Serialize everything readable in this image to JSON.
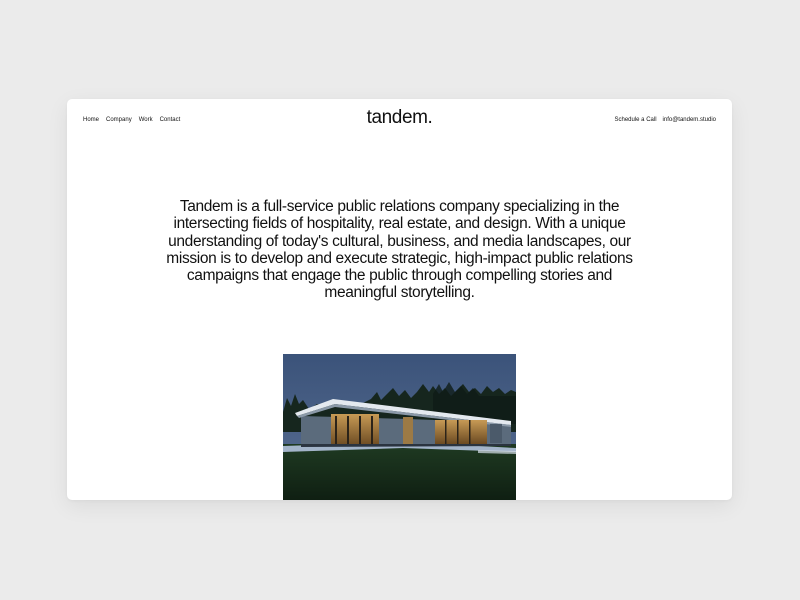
{
  "header": {
    "nav_left": [
      "Home",
      "Company",
      "Work",
      "Contact"
    ],
    "logo": "tandem.",
    "nav_right": {
      "schedule": "Schedule a Call",
      "email": "info@tandem.studio"
    }
  },
  "main": {
    "mission": "Tandem is a full-service public relations company specializing in the intersecting fields of hospitality, real estate, and design. With a unique understanding of today's cultural, business, and media landscapes, our mission is to develop and execute strategic, high-impact public relations campaigns that engage the public through compelling stories and meaningful storytelling."
  },
  "colors": {
    "page_background": "#ebebeb",
    "card_background": "#ffffff",
    "text": "#111111",
    "sky": "#3e5679"
  }
}
